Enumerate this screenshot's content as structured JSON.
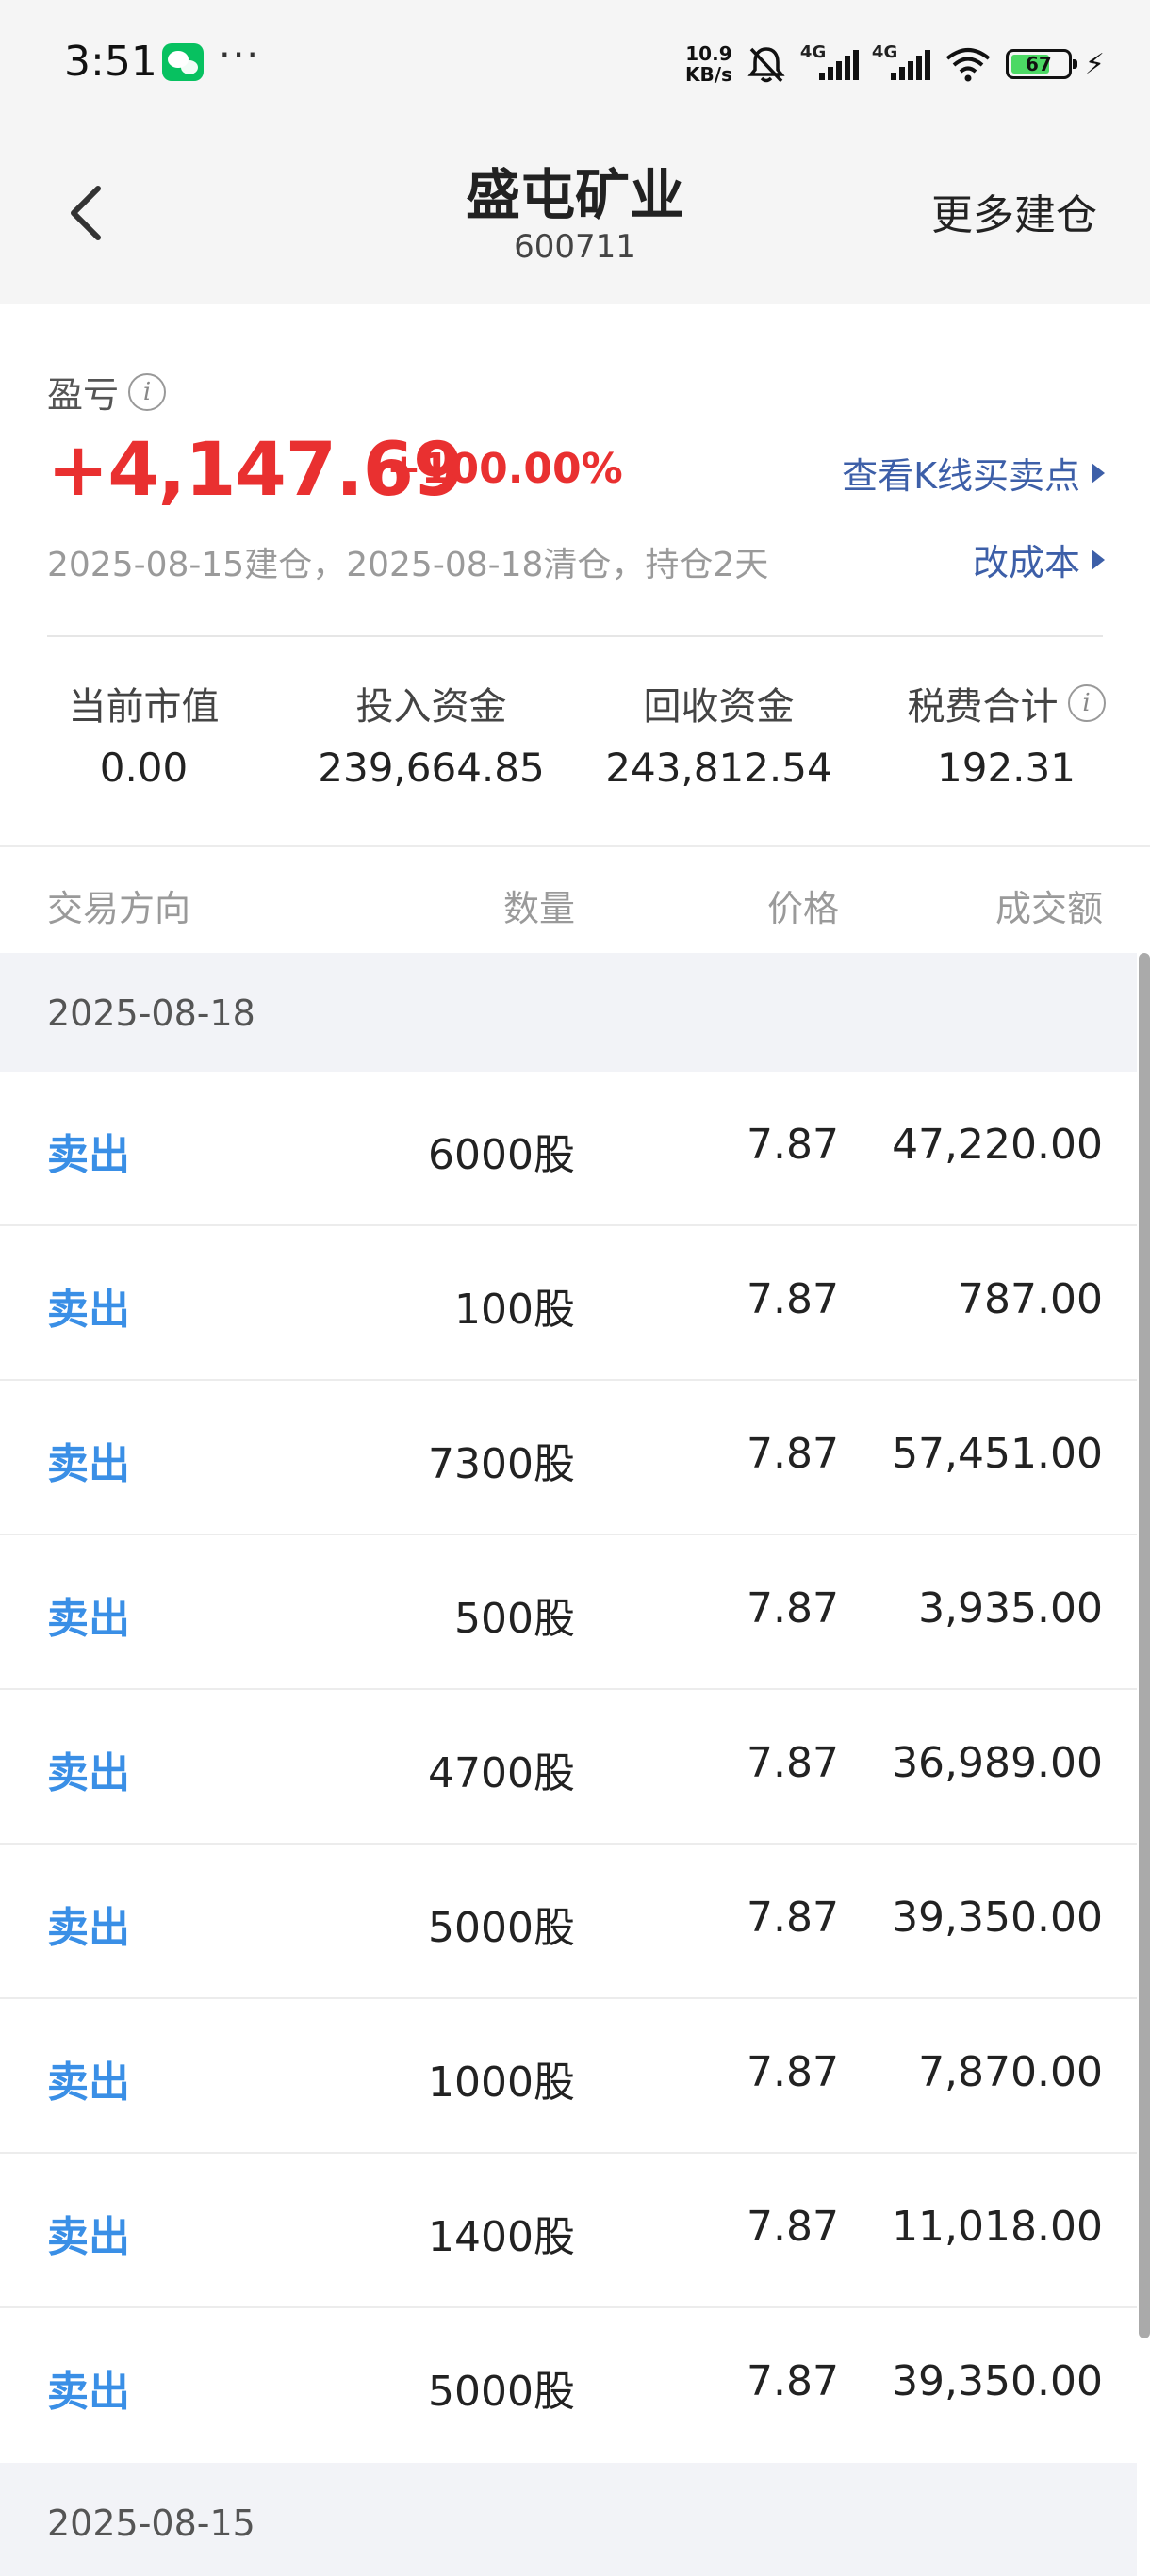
{
  "status_bar": {
    "time": "3:51",
    "more": "···",
    "net_speed_value": "10.9",
    "net_speed_unit": "KB/s",
    "signal1_tag": "4G",
    "signal2_tag": "4G",
    "battery": "67"
  },
  "header": {
    "title": "盛屯矿业",
    "code": "600711",
    "action": "更多建仓"
  },
  "summary": {
    "pl_label": "盈亏",
    "pl_value": "+4,147.69",
    "pl_percent": "+100.00%",
    "link_kline": "查看K线买卖点",
    "link_cost": "改成本",
    "dates": "2025-08-15建仓，2025-08-18清仓，持仓2天",
    "metrics": [
      {
        "label": "当前市值",
        "value": "0.00"
      },
      {
        "label": "投入资金",
        "value": "239,664.85"
      },
      {
        "label": "回收资金",
        "value": "243,812.54"
      },
      {
        "label": "税费合计",
        "value": "192.31"
      }
    ]
  },
  "table": {
    "headers": {
      "direction": "交易方向",
      "quantity": "数量",
      "price": "价格",
      "amount": "成交额"
    },
    "groups": [
      {
        "date": "2025-08-18",
        "rows": [
          {
            "direction": "卖出",
            "quantity": "6000股",
            "price": "7.87",
            "amount": "47,220.00"
          },
          {
            "direction": "卖出",
            "quantity": "100股",
            "price": "7.87",
            "amount": "787.00"
          },
          {
            "direction": "卖出",
            "quantity": "7300股",
            "price": "7.87",
            "amount": "57,451.00"
          },
          {
            "direction": "卖出",
            "quantity": "500股",
            "price": "7.87",
            "amount": "3,935.00"
          },
          {
            "direction": "卖出",
            "quantity": "4700股",
            "price": "7.87",
            "amount": "36,989.00"
          },
          {
            "direction": "卖出",
            "quantity": "5000股",
            "price": "7.87",
            "amount": "39,350.00"
          },
          {
            "direction": "卖出",
            "quantity": "1000股",
            "price": "7.87",
            "amount": "7,870.00"
          },
          {
            "direction": "卖出",
            "quantity": "1400股",
            "price": "7.87",
            "amount": "11,018.00"
          },
          {
            "direction": "卖出",
            "quantity": "5000股",
            "price": "7.87",
            "amount": "39,350.00"
          }
        ]
      },
      {
        "date": "2025-08-15",
        "rows": []
      }
    ]
  }
}
